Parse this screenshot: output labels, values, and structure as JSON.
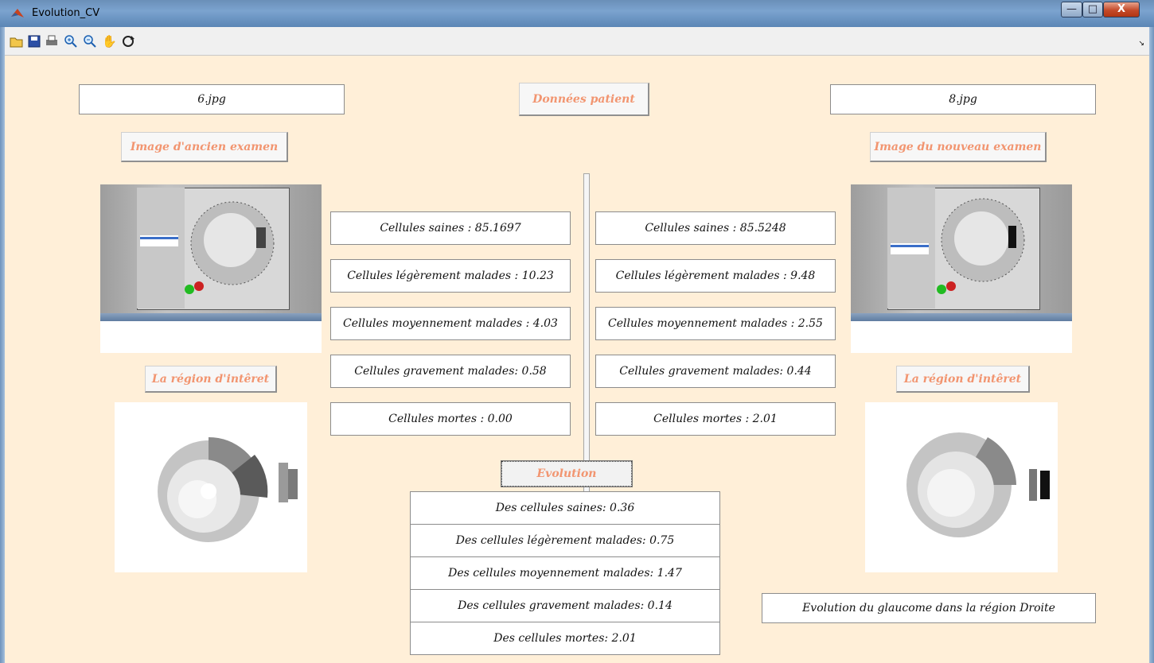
{
  "window": {
    "title": "Evolution_CV",
    "buttons": {
      "minimize": "—",
      "maximize": "□",
      "close": "X"
    }
  },
  "toolbar": {
    "icons": [
      "open-icon",
      "save-icon",
      "print-icon",
      "zoom-in-icon",
      "zoom-out-icon",
      "pan-hand-icon",
      "rotate-3d-icon"
    ]
  },
  "left": {
    "filename": "6.jpg",
    "exam_button": "Image d'ancien examen",
    "roi_button": "La région d'intêret",
    "stats": [
      "Cellules saines : 85.1697",
      "Cellules légèrement malades : 10.23",
      "Cellules moyennement malades : 4.03",
      "Cellules gravement malades: 0.58",
      "Cellules mortes : 0.00"
    ]
  },
  "right": {
    "filename": "8.jpg",
    "exam_button": "Image du nouveau examen",
    "roi_button": "La région d'intêret",
    "stats": [
      "Cellules saines : 85.5248",
      "Cellules légèrement malades : 9.48",
      "Cellules moyennement malades : 2.55",
      "Cellules gravement malades: 0.44",
      "Cellules mortes : 2.01"
    ]
  },
  "center": {
    "patient_button": "Données patient",
    "evolution_button": "Evolution",
    "evolution": [
      "Des cellules saines: 0.36",
      "Des cellules légèrement malades: 0.75",
      "Des cellules moyennement malades: 1.47",
      "Des cellules gravement malades: 0.14",
      "Des cellules mortes: 2.01"
    ]
  },
  "conclusion": "Evolution du glaucome dans la région Droite",
  "colors": {
    "background": "#ffefd8",
    "button_text": "#f29570"
  }
}
